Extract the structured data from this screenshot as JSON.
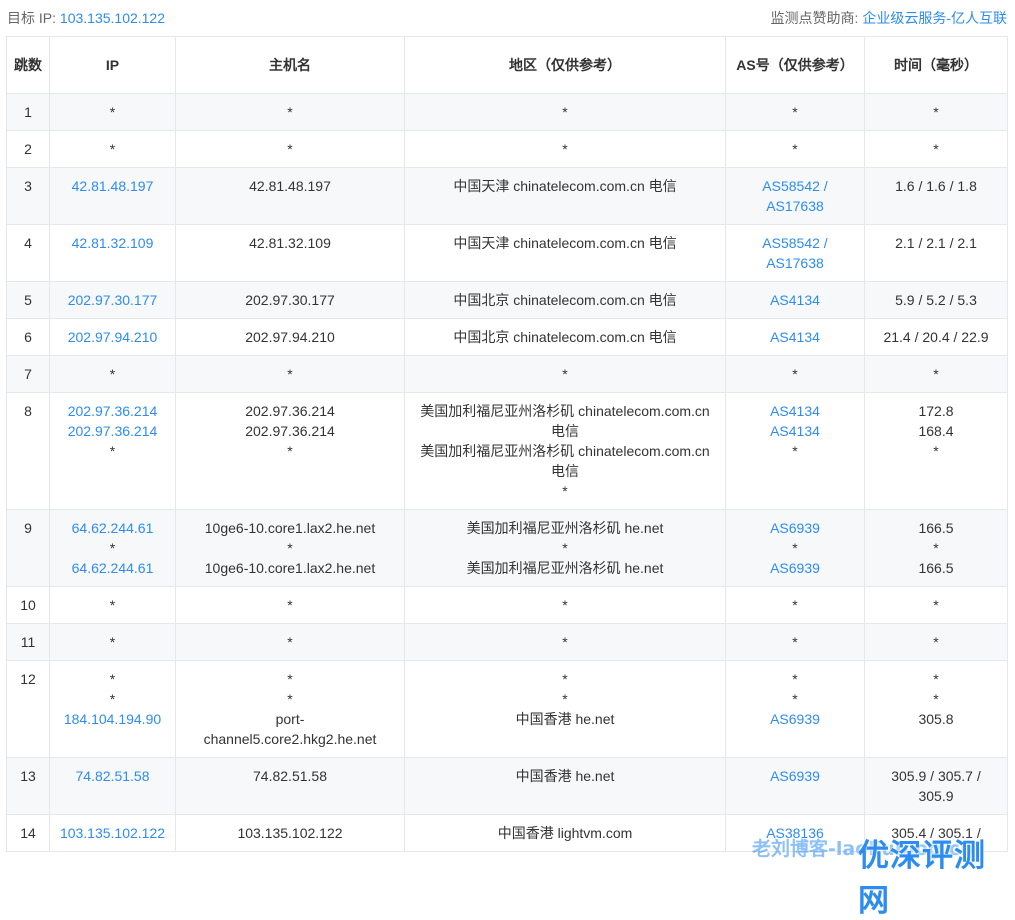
{
  "header": {
    "target_label": "目标 IP:",
    "target_ip": "103.135.102.122",
    "sponsor_label": "监测点赞助商:",
    "sponsor_link": "企业级云服务-亿人互联"
  },
  "table": {
    "headers": [
      "跳数",
      "IP",
      "主机名",
      "地区（仅供参考）",
      "AS号（仅供参考）",
      "时间（毫秒）"
    ],
    "rows": [
      {
        "hop": "1",
        "ip": [
          "*"
        ],
        "host": [
          "*"
        ],
        "region": [
          "*"
        ],
        "asn": [
          "*"
        ],
        "time": [
          "*"
        ]
      },
      {
        "hop": "2",
        "ip": [
          "*"
        ],
        "host": [
          "*"
        ],
        "region": [
          "*"
        ],
        "asn": [
          "*"
        ],
        "time": [
          "*"
        ]
      },
      {
        "hop": "3",
        "ip": [
          "42.81.48.197"
        ],
        "host": [
          "42.81.48.197"
        ],
        "region": [
          "中国天津 chinatelecom.com.cn 电信"
        ],
        "asn": [
          "AS58542 /",
          "AS17638"
        ],
        "time": [
          "1.6 / 1.6 / 1.8"
        ]
      },
      {
        "hop": "4",
        "ip": [
          "42.81.32.109"
        ],
        "host": [
          "42.81.32.109"
        ],
        "region": [
          "中国天津 chinatelecom.com.cn 电信"
        ],
        "asn": [
          "AS58542 /",
          "AS17638"
        ],
        "time": [
          "2.1 / 2.1 / 2.1"
        ]
      },
      {
        "hop": "5",
        "ip": [
          "202.97.30.177"
        ],
        "host": [
          "202.97.30.177"
        ],
        "region": [
          "中国北京 chinatelecom.com.cn 电信"
        ],
        "asn": [
          "AS4134"
        ],
        "time": [
          "5.9 / 5.2 / 5.3"
        ]
      },
      {
        "hop": "6",
        "ip": [
          "202.97.94.210"
        ],
        "host": [
          "202.97.94.210"
        ],
        "region": [
          "中国北京 chinatelecom.com.cn 电信"
        ],
        "asn": [
          "AS4134"
        ],
        "time": [
          "21.4 / 20.4 / 22.9"
        ]
      },
      {
        "hop": "7",
        "ip": [
          "*"
        ],
        "host": [
          "*"
        ],
        "region": [
          "*"
        ],
        "asn": [
          "*"
        ],
        "time": [
          "*"
        ]
      },
      {
        "hop": "8",
        "ip": [
          "202.97.36.214",
          "202.97.36.214",
          "*"
        ],
        "host": [
          "202.97.36.214",
          "202.97.36.214",
          "*"
        ],
        "region": [
          "美国加利福尼亚州洛杉矶 chinatelecom.com.cn",
          "电信",
          "美国加利福尼亚州洛杉矶 chinatelecom.com.cn",
          "电信",
          "*"
        ],
        "asn": [
          "AS4134",
          "AS4134",
          "*"
        ],
        "time": [
          "172.8",
          "168.4",
          "*"
        ]
      },
      {
        "hop": "9",
        "ip": [
          "64.62.244.61",
          "*",
          "64.62.244.61"
        ],
        "host": [
          "10ge6-10.core1.lax2.he.net",
          "*",
          "10ge6-10.core1.lax2.he.net"
        ],
        "region": [
          "美国加利福尼亚州洛杉矶 he.net",
          "*",
          "美国加利福尼亚州洛杉矶 he.net"
        ],
        "asn": [
          "AS6939",
          "*",
          "AS6939"
        ],
        "time": [
          "166.5",
          "*",
          "166.5"
        ]
      },
      {
        "hop": "10",
        "ip": [
          "*"
        ],
        "host": [
          "*"
        ],
        "region": [
          "*"
        ],
        "asn": [
          "*"
        ],
        "time": [
          "*"
        ]
      },
      {
        "hop": "11",
        "ip": [
          "*"
        ],
        "host": [
          "*"
        ],
        "region": [
          "*"
        ],
        "asn": [
          "*"
        ],
        "time": [
          "*"
        ]
      },
      {
        "hop": "12",
        "ip": [
          "*",
          "*",
          "184.104.194.90"
        ],
        "host": [
          "*",
          "*",
          "port-",
          "channel5.core2.hkg2.he.net"
        ],
        "region": [
          "*",
          "*",
          "中国香港 he.net"
        ],
        "asn": [
          "*",
          "*",
          "AS6939"
        ],
        "time": [
          "*",
          "*",
          "305.8"
        ]
      },
      {
        "hop": "13",
        "ip": [
          "74.82.51.58"
        ],
        "host": [
          "74.82.51.58"
        ],
        "region": [
          "中国香港 he.net"
        ],
        "asn": [
          "AS6939"
        ],
        "time": [
          "305.9 / 305.7 /",
          "305.9"
        ]
      },
      {
        "hop": "14",
        "ip": [
          "103.135.102.122"
        ],
        "host": [
          "103.135.102.122"
        ],
        "region": [
          "中国香港 lightvm.com"
        ],
        "asn": [
          "AS38136"
        ],
        "time": [
          "305.4 / 305.1 /"
        ]
      }
    ]
  },
  "watermark": {
    "text_small": "老刘博客-laoliublog.cn",
    "text_large": "优深评测网"
  },
  "colors": {
    "link": "#2d8cf0",
    "border": "#e5e7eb",
    "stripe": "#f7f8f9"
  }
}
